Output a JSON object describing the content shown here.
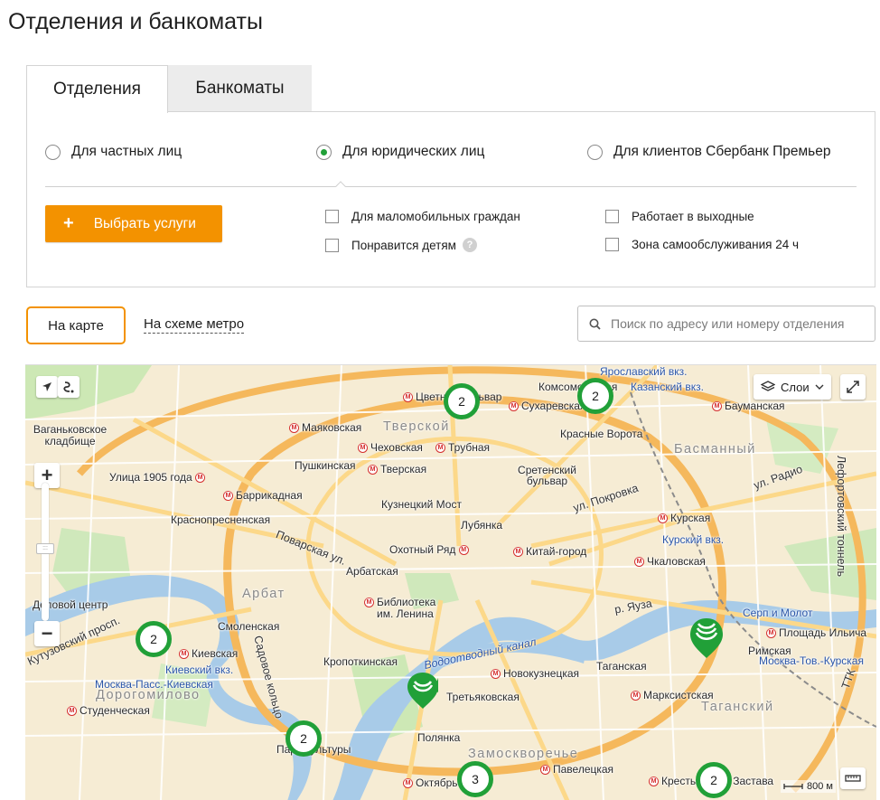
{
  "page": {
    "title": "Отделения и банкоматы"
  },
  "tabs": [
    {
      "label": "Отделения",
      "active": true
    },
    {
      "label": "Банкоматы",
      "active": false
    }
  ],
  "client_types": [
    {
      "label": "Для частных лиц",
      "selected": false
    },
    {
      "label": "Для юридических лиц",
      "selected": true
    },
    {
      "label": "Для клиентов Сбербанк Премьер",
      "selected": false
    }
  ],
  "services_button": {
    "plus": "+",
    "label": "Выбрать услуги"
  },
  "filters": [
    {
      "label": "Для маломобильных граждан",
      "checked": false
    },
    {
      "label": "Понравится детям",
      "checked": false,
      "help": "?"
    },
    {
      "label": "Работает в выходные",
      "checked": false
    },
    {
      "label": "Зона самообслуживания 24 ч",
      "checked": false
    }
  ],
  "view": {
    "map_label": "На карте",
    "metro_label": "На схеме метро"
  },
  "search": {
    "placeholder": "Поиск по адресу или номеру отделения"
  },
  "map": {
    "layers_label": "Слои",
    "scale_label": "800 м",
    "clusters": [
      "2",
      "2",
      "2",
      "2",
      "3",
      "2"
    ],
    "districts": [
      "Тверской",
      "Басманный",
      "Арбат",
      "Дорогомилово",
      "Замоскворечье",
      "Таганский"
    ],
    "metro_stations": [
      "Цветной бульвар",
      "Сухаревская",
      "Комсомольская",
      "Маяковская",
      "Чеховская",
      "Трубная",
      "Красные Ворота",
      "Бауманская",
      "Пушкинская",
      "Тверская",
      "Сретенский бульвар",
      "Улица 1905 года",
      "Баррикадная",
      "Краснопресненская",
      "Кузнецкий Мост",
      "Лубянка",
      "Охотный Ряд",
      "Курская",
      "Китай-город",
      "Чкаловская",
      "Арбатская",
      "Смоленская",
      "Библиотека им. Ленина",
      "Киевская",
      "Кропоткинская",
      "Таганская",
      "Новокузнецкая",
      "Марксистская",
      "Третьяковская",
      "Полянка",
      "Римская",
      "Площадь Ильича",
      "Студенческая",
      "Павелецкая",
      "Октябрьская",
      "Крестьянская Застава",
      "Парк Культуры",
      "Серп и Молот",
      "Ваганьковское кладбище",
      "Деловой центр"
    ],
    "rail_stations": [
      "Ярославский вкз.",
      "Казанский вкз.",
      "Курский вкз.",
      "Киевский вкз.",
      "Москва-Пасс.-Киевская",
      "Москва-Тов.-Курская"
    ],
    "streets": [
      "Поварская ул.",
      "ул. Покровка",
      "р. Яуза",
      "Садовое кольцо",
      "Кутузовский просп.",
      "Водоотводный канал",
      "Лефортовский тоннель",
      "ул. Радио",
      "ТТК"
    ]
  }
}
